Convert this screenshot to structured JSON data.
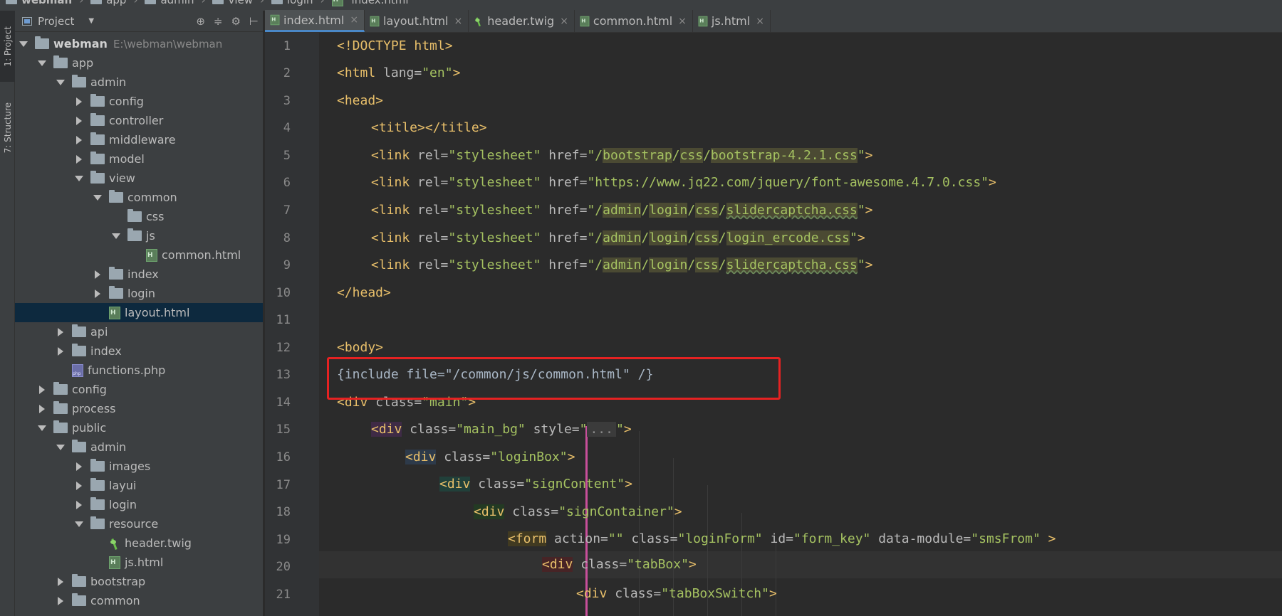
{
  "breadcrumb": [
    "webman",
    "app",
    "admin",
    "view",
    "login",
    "index.html"
  ],
  "side_tabs": {
    "project": "1: Project",
    "structure": "7: Structure"
  },
  "project_panel": {
    "title": "Project",
    "tree": [
      {
        "label": "webman",
        "path": "E:\\webman\\webman",
        "bold": true
      },
      {
        "label": "app"
      },
      {
        "label": "admin"
      },
      {
        "label": "config"
      },
      {
        "label": "controller"
      },
      {
        "label": "middleware"
      },
      {
        "label": "model"
      },
      {
        "label": "view"
      },
      {
        "label": "common"
      },
      {
        "label": "css"
      },
      {
        "label": "js"
      },
      {
        "label": "common.html"
      },
      {
        "label": "index"
      },
      {
        "label": "login"
      },
      {
        "label": "layout.html"
      },
      {
        "label": "api"
      },
      {
        "label": "index"
      },
      {
        "label": "functions.php"
      },
      {
        "label": "config"
      },
      {
        "label": "process"
      },
      {
        "label": "public"
      },
      {
        "label": "admin"
      },
      {
        "label": "images"
      },
      {
        "label": "layui"
      },
      {
        "label": "login"
      },
      {
        "label": "resource"
      },
      {
        "label": "header.twig"
      },
      {
        "label": "js.html"
      },
      {
        "label": "bootstrap"
      },
      {
        "label": "common"
      }
    ]
  },
  "tabs": [
    {
      "label": "index.html"
    },
    {
      "label": "layout.html"
    },
    {
      "label": "header.twig"
    },
    {
      "label": "common.html"
    },
    {
      "label": "js.html"
    }
  ],
  "line_numbers": [
    "1",
    "2",
    "3",
    "4",
    "5",
    "6",
    "7",
    "8",
    "9",
    "10",
    "11",
    "12",
    "13",
    "14",
    "15",
    "16",
    "17",
    "18",
    "19",
    "20",
    "21"
  ],
  "code": {
    "l1": "<!DOCTYPE html>",
    "l2_tag": "<html ",
    "l2_attr": "lang=",
    "l2_val": "\"en\"",
    "l2_end": ">",
    "l3": "<head>",
    "l4": "<title></title>",
    "l5_a": "<link ",
    "l5_b": "rel=",
    "l5_c": "\"stylesheet\" ",
    "l5_d": "href=",
    "l5_e": "\"/",
    "l5_f": "bootstrap",
    "l5_g": "/",
    "l5_h": "css",
    "l5_i": "/",
    "l5_j": "bootstrap-4.2.1.css",
    "l5_k": "\"",
    "l5_l": ">",
    "l6_a": "<link ",
    "l6_b": "rel=",
    "l6_c": "\"stylesheet\" ",
    "l6_d": "href=",
    "l6_e": "\"https://www.jq22.com/jquery/font-awesome.4.7.0.css\"",
    "l6_f": ">",
    "l7_a": "<link ",
    "l7_b": "rel=",
    "l7_c": "\"stylesheet\" ",
    "l7_d": "href=",
    "l7_e": "\"/",
    "l7_f": "admin",
    "l7_g": "/",
    "l7_h": "login",
    "l7_i": "/",
    "l7_j": "css",
    "l7_k": "/",
    "l7_l": "slidercaptcha.css",
    "l7_m": "\"",
    "l7_n": ">",
    "l8_a": "<link ",
    "l8_b": "rel=",
    "l8_c": "\"stylesheet\" ",
    "l8_d": "href=",
    "l8_e": "\"/",
    "l8_f": "admin",
    "l8_g": "/",
    "l8_h": "login",
    "l8_i": "/",
    "l8_j": "css",
    "l8_k": "/",
    "l8_l": "login_ercode.css",
    "l8_m": "\"",
    "l8_n": ">",
    "l9_a": "<link ",
    "l9_b": "rel=",
    "l9_c": "\"stylesheet\" ",
    "l9_d": "href=",
    "l9_e": "\"/",
    "l9_f": "admin",
    "l9_g": "/",
    "l9_h": "login",
    "l9_i": "/",
    "l9_j": "css",
    "l9_k": "/",
    "l9_l": "slidercaptcha.css",
    "l9_m": "\"",
    "l9_n": ">",
    "l10": "</head>",
    "l12": "<body>",
    "l13": "{include file=\"/common/js/common.html\" /}",
    "l14_a": "<div ",
    "l14_b": "class=",
    "l14_c": "\"main\"",
    "l14_d": ">",
    "l15_a": "<div",
    "l15_b": " class=",
    "l15_c": "\"main_bg\" ",
    "l15_d": "style=",
    "l15_e": "\"",
    "l15_f": "...",
    "l15_g": "\"",
    "l15_h": ">",
    "l16_a": "<div",
    "l16_b": " class=",
    "l16_c": "\"loginBox\"",
    "l16_d": ">",
    "l17_a": "<div",
    "l17_b": " class=",
    "l17_c": "\"signContent\"",
    "l17_d": ">",
    "l18_a": "<div",
    "l18_b": " class=",
    "l18_c": "\"signContainer\"",
    "l18_d": ">",
    "l19_a": "<form",
    "l19_b": " action=",
    "l19_c": "\"\" ",
    "l19_d": "class=",
    "l19_e": "\"loginForm\" ",
    "l19_f": "id=",
    "l19_g": "\"form_key\" ",
    "l19_h": "data-module=",
    "l19_i": "\"smsFrom\" ",
    "l19_j": ">",
    "l20_a": "<div",
    "l20_b": " class=",
    "l20_c": "\"tabBox\"",
    "l20_d": ">",
    "l21_a": "<div ",
    "l21_b": "class=",
    "l21_c": "\"tabBoxSwitch\"",
    "l21_d": ">"
  }
}
